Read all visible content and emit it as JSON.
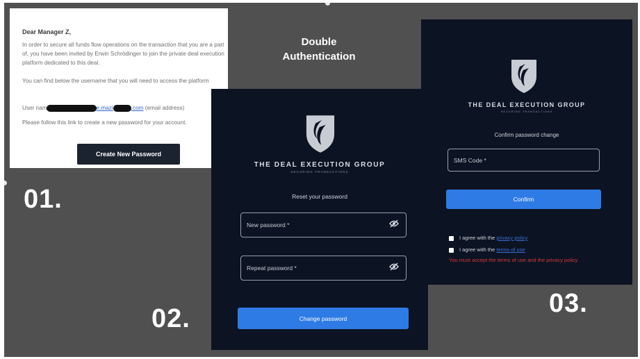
{
  "heading": {
    "line1": "Double",
    "line2": "Authentication"
  },
  "steps": {
    "one": "01.",
    "two": "02.",
    "three": "03."
  },
  "email": {
    "greeting": "Dear Manager Z,",
    "para1": "In order to secure all funds flow operations on the transaction that you are a part of, you have been invited by Erwin Schrödinger to join the private deal execution platform dedicated to this deal.",
    "para2": "You can find below the username that you will need to access the platform",
    "username_prefix": "User name:",
    "username_mid": "e.mazi",
    "username_end": ".com",
    "username_suffix": "(email address)",
    "para3": "Please follow this link to create a new password for your account.",
    "button": "Create New Password"
  },
  "brand": {
    "name": "THE DEAL EXECUTION GROUP",
    "tagline": "SECURING TRANSACTIONS"
  },
  "reset": {
    "title": "Reset your password",
    "new_password": "New password *",
    "repeat_password": "Repeat password *",
    "button": "Change password"
  },
  "confirm": {
    "title": "Confirm password change",
    "sms_code": "SMS Code *",
    "button": "Confirm",
    "agree_privacy_prefix": "I agree with the",
    "agree_privacy_link": "privacy policy",
    "agree_terms_prefix": "I agree with the",
    "agree_terms_link": "terms of use",
    "error": "You must accept the terms of use and the privacy policy"
  },
  "colors": {
    "panel_bg": "#0c1322",
    "accent": "#2f7be6",
    "error": "#d63a3a",
    "stage_bg": "#505050"
  },
  "icons": [
    "shield-logo-icon",
    "eye-off-icon"
  ]
}
